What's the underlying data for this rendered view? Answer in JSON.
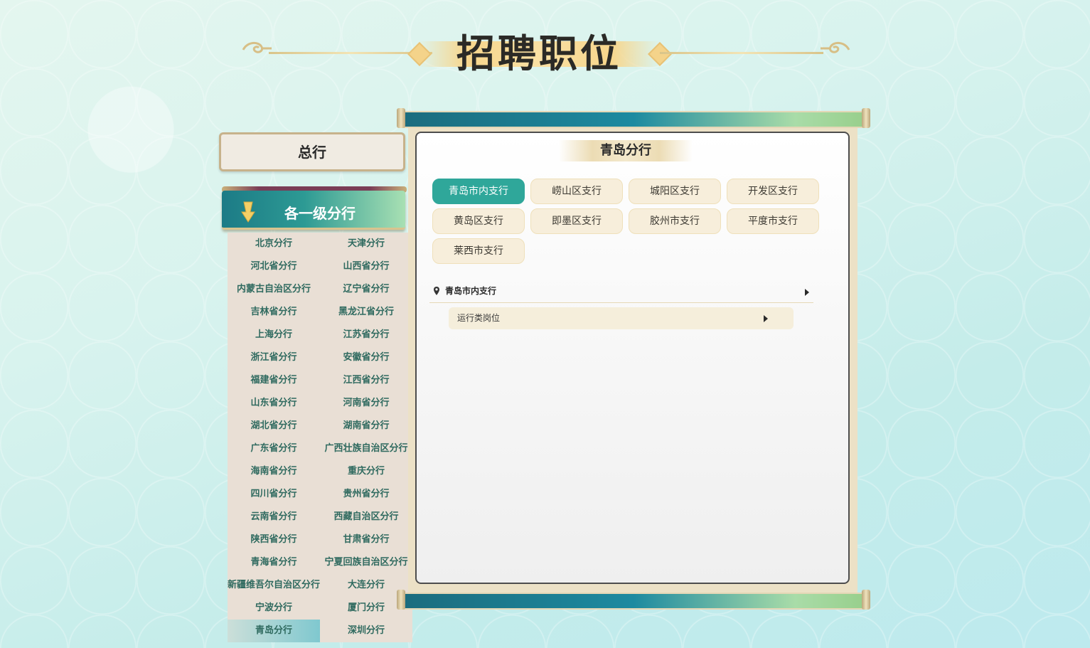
{
  "page_title": "招聘职位",
  "sidebar": {
    "hq_label": "总行",
    "branch_header": "各一级分行",
    "branches": [
      "北京分行",
      "天津分行",
      "河北省分行",
      "山西省分行",
      "内蒙古自治区分行",
      "辽宁省分行",
      "吉林省分行",
      "黑龙江省分行",
      "上海分行",
      "江苏省分行",
      "浙江省分行",
      "安徽省分行",
      "福建省分行",
      "江西省分行",
      "山东省分行",
      "河南省分行",
      "湖北省分行",
      "湖南省分行",
      "广东省分行",
      "广西壮族自治区分行",
      "海南省分行",
      "重庆分行",
      "四川省分行",
      "贵州省分行",
      "云南省分行",
      "西藏自治区分行",
      "陕西省分行",
      "甘肃省分行",
      "青海省分行",
      "宁夏回族自治区分行",
      "新疆维吾尔自治区分行",
      "大连分行",
      "宁波分行",
      "厦门分行",
      "青岛分行",
      "深圳分行"
    ],
    "selected_branch": "青岛分行"
  },
  "panel": {
    "title": "青岛分行",
    "sub_branches": [
      "青岛市内支行",
      "崂山区支行",
      "城阳区支行",
      "开发区支行",
      "黄岛区支行",
      "即墨区支行",
      "胶州市支行",
      "平度市支行",
      "莱西市支行"
    ],
    "selected_sub_branch": "青岛市内支行",
    "location_label": "青岛市内支行",
    "jobs": [
      "运行类岗位"
    ]
  },
  "colors": {
    "accent": "#2fa79a",
    "branch_text": "#2f6a5f",
    "sidebar_bg": "#e9dfd5"
  },
  "icons": {
    "title_ornament": "cloud-swirl-icon",
    "branch_arrow": "chevron-down-icon",
    "location": "map-pin-icon",
    "expand": "caret-right-icon"
  }
}
